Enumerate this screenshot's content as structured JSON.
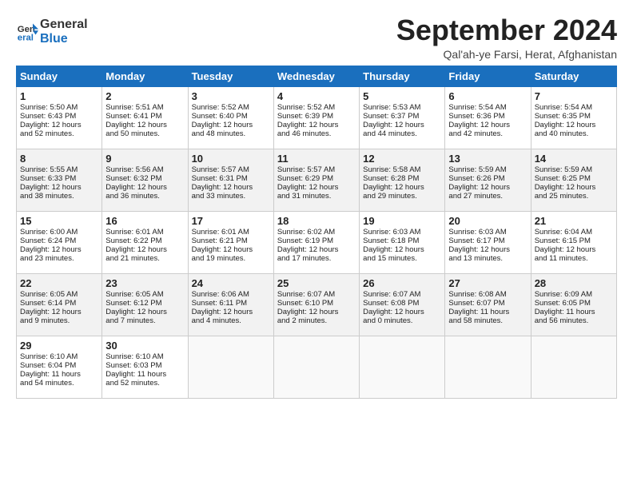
{
  "logo": {
    "line1": "General",
    "line2": "Blue"
  },
  "title": "September 2024",
  "subtitle": "Qal'ah-ye Farsi, Herat, Afghanistan",
  "days_of_week": [
    "Sunday",
    "Monday",
    "Tuesday",
    "Wednesday",
    "Thursday",
    "Friday",
    "Saturday"
  ],
  "weeks": [
    [
      {
        "day": "1",
        "lines": [
          "Sunrise: 5:50 AM",
          "Sunset: 6:43 PM",
          "Daylight: 12 hours",
          "and 52 minutes."
        ]
      },
      {
        "day": "2",
        "lines": [
          "Sunrise: 5:51 AM",
          "Sunset: 6:41 PM",
          "Daylight: 12 hours",
          "and 50 minutes."
        ]
      },
      {
        "day": "3",
        "lines": [
          "Sunrise: 5:52 AM",
          "Sunset: 6:40 PM",
          "Daylight: 12 hours",
          "and 48 minutes."
        ]
      },
      {
        "day": "4",
        "lines": [
          "Sunrise: 5:52 AM",
          "Sunset: 6:39 PM",
          "Daylight: 12 hours",
          "and 46 minutes."
        ]
      },
      {
        "day": "5",
        "lines": [
          "Sunrise: 5:53 AM",
          "Sunset: 6:37 PM",
          "Daylight: 12 hours",
          "and 44 minutes."
        ]
      },
      {
        "day": "6",
        "lines": [
          "Sunrise: 5:54 AM",
          "Sunset: 6:36 PM",
          "Daylight: 12 hours",
          "and 42 minutes."
        ]
      },
      {
        "day": "7",
        "lines": [
          "Sunrise: 5:54 AM",
          "Sunset: 6:35 PM",
          "Daylight: 12 hours",
          "and 40 minutes."
        ]
      }
    ],
    [
      {
        "day": "8",
        "lines": [
          "Sunrise: 5:55 AM",
          "Sunset: 6:33 PM",
          "Daylight: 12 hours",
          "and 38 minutes."
        ]
      },
      {
        "day": "9",
        "lines": [
          "Sunrise: 5:56 AM",
          "Sunset: 6:32 PM",
          "Daylight: 12 hours",
          "and 36 minutes."
        ]
      },
      {
        "day": "10",
        "lines": [
          "Sunrise: 5:57 AM",
          "Sunset: 6:31 PM",
          "Daylight: 12 hours",
          "and 33 minutes."
        ]
      },
      {
        "day": "11",
        "lines": [
          "Sunrise: 5:57 AM",
          "Sunset: 6:29 PM",
          "Daylight: 12 hours",
          "and 31 minutes."
        ]
      },
      {
        "day": "12",
        "lines": [
          "Sunrise: 5:58 AM",
          "Sunset: 6:28 PM",
          "Daylight: 12 hours",
          "and 29 minutes."
        ]
      },
      {
        "day": "13",
        "lines": [
          "Sunrise: 5:59 AM",
          "Sunset: 6:26 PM",
          "Daylight: 12 hours",
          "and 27 minutes."
        ]
      },
      {
        "day": "14",
        "lines": [
          "Sunrise: 5:59 AM",
          "Sunset: 6:25 PM",
          "Daylight: 12 hours",
          "and 25 minutes."
        ]
      }
    ],
    [
      {
        "day": "15",
        "lines": [
          "Sunrise: 6:00 AM",
          "Sunset: 6:24 PM",
          "Daylight: 12 hours",
          "and 23 minutes."
        ]
      },
      {
        "day": "16",
        "lines": [
          "Sunrise: 6:01 AM",
          "Sunset: 6:22 PM",
          "Daylight: 12 hours",
          "and 21 minutes."
        ]
      },
      {
        "day": "17",
        "lines": [
          "Sunrise: 6:01 AM",
          "Sunset: 6:21 PM",
          "Daylight: 12 hours",
          "and 19 minutes."
        ]
      },
      {
        "day": "18",
        "lines": [
          "Sunrise: 6:02 AM",
          "Sunset: 6:19 PM",
          "Daylight: 12 hours",
          "and 17 minutes."
        ]
      },
      {
        "day": "19",
        "lines": [
          "Sunrise: 6:03 AM",
          "Sunset: 6:18 PM",
          "Daylight: 12 hours",
          "and 15 minutes."
        ]
      },
      {
        "day": "20",
        "lines": [
          "Sunrise: 6:03 AM",
          "Sunset: 6:17 PM",
          "Daylight: 12 hours",
          "and 13 minutes."
        ]
      },
      {
        "day": "21",
        "lines": [
          "Sunrise: 6:04 AM",
          "Sunset: 6:15 PM",
          "Daylight: 12 hours",
          "and 11 minutes."
        ]
      }
    ],
    [
      {
        "day": "22",
        "lines": [
          "Sunrise: 6:05 AM",
          "Sunset: 6:14 PM",
          "Daylight: 12 hours",
          "and 9 minutes."
        ]
      },
      {
        "day": "23",
        "lines": [
          "Sunrise: 6:05 AM",
          "Sunset: 6:12 PM",
          "Daylight: 12 hours",
          "and 7 minutes."
        ]
      },
      {
        "day": "24",
        "lines": [
          "Sunrise: 6:06 AM",
          "Sunset: 6:11 PM",
          "Daylight: 12 hours",
          "and 4 minutes."
        ]
      },
      {
        "day": "25",
        "lines": [
          "Sunrise: 6:07 AM",
          "Sunset: 6:10 PM",
          "Daylight: 12 hours",
          "and 2 minutes."
        ]
      },
      {
        "day": "26",
        "lines": [
          "Sunrise: 6:07 AM",
          "Sunset: 6:08 PM",
          "Daylight: 12 hours",
          "and 0 minutes."
        ]
      },
      {
        "day": "27",
        "lines": [
          "Sunrise: 6:08 AM",
          "Sunset: 6:07 PM",
          "Daylight: 11 hours",
          "and 58 minutes."
        ]
      },
      {
        "day": "28",
        "lines": [
          "Sunrise: 6:09 AM",
          "Sunset: 6:05 PM",
          "Daylight: 11 hours",
          "and 56 minutes."
        ]
      }
    ],
    [
      {
        "day": "29",
        "lines": [
          "Sunrise: 6:10 AM",
          "Sunset: 6:04 PM",
          "Daylight: 11 hours",
          "and 54 minutes."
        ]
      },
      {
        "day": "30",
        "lines": [
          "Sunrise: 6:10 AM",
          "Sunset: 6:03 PM",
          "Daylight: 11 hours",
          "and 52 minutes."
        ]
      },
      {
        "day": "",
        "lines": []
      },
      {
        "day": "",
        "lines": []
      },
      {
        "day": "",
        "lines": []
      },
      {
        "day": "",
        "lines": []
      },
      {
        "day": "",
        "lines": []
      }
    ]
  ]
}
